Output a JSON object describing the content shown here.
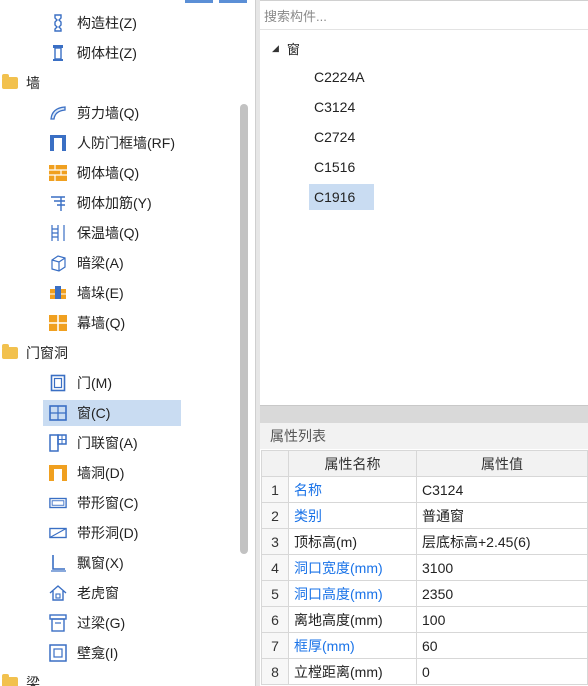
{
  "tree": {
    "items": [
      {
        "label": "构造柱(Z)",
        "icon": "constructional-column-icon",
        "level": 2
      },
      {
        "label": "砌体柱(Z)",
        "icon": "masonry-column-icon",
        "level": 2
      },
      {
        "label": "墙",
        "icon": "folder-icon",
        "level": 1
      },
      {
        "label": "剪力墙(Q)",
        "icon": "shear-wall-icon",
        "level": 2
      },
      {
        "label": "人防门框墙(RF)",
        "icon": "civil-defense-door-frame-wall-icon",
        "level": 2
      },
      {
        "label": "砌体墙(Q)",
        "icon": "masonry-wall-icon",
        "level": 2
      },
      {
        "label": "砌体加筋(Y)",
        "icon": "masonry-reinforcement-icon",
        "level": 2
      },
      {
        "label": "保温墙(Q)",
        "icon": "insulation-wall-icon",
        "level": 2
      },
      {
        "label": "暗梁(A)",
        "icon": "hidden-beam-icon",
        "level": 2
      },
      {
        "label": "墙垛(E)",
        "icon": "wall-pier-icon",
        "level": 2
      },
      {
        "label": "幕墙(Q)",
        "icon": "curtain-wall-icon",
        "level": 2
      },
      {
        "label": "门窗洞",
        "icon": "folder-icon",
        "level": 1
      },
      {
        "label": "门(M)",
        "icon": "door-icon",
        "level": 2
      },
      {
        "label": "窗(C)",
        "icon": "window-icon",
        "level": 2,
        "selected": true
      },
      {
        "label": "门联窗(A)",
        "icon": "door-window-icon",
        "level": 2
      },
      {
        "label": "墙洞(D)",
        "icon": "wall-hole-icon",
        "level": 2
      },
      {
        "label": "带形窗(C)",
        "icon": "strip-window-icon",
        "level": 2
      },
      {
        "label": "带形洞(D)",
        "icon": "strip-hole-icon",
        "level": 2
      },
      {
        "label": "飘窗(X)",
        "icon": "bay-window-icon",
        "level": 2
      },
      {
        "label": "老虎窗",
        "icon": "dormer-window-icon",
        "level": 2
      },
      {
        "label": "过梁(G)",
        "icon": "lintel-icon",
        "level": 2
      },
      {
        "label": "壁龛(I)",
        "icon": "niche-icon",
        "level": 2
      },
      {
        "label": "梁",
        "icon": "folder-icon",
        "level": 1
      }
    ]
  },
  "search": {
    "placeholder": "搜索构件..."
  },
  "components": {
    "root_label": "窗",
    "items": [
      {
        "label": "C2224A"
      },
      {
        "label": "C3124"
      },
      {
        "label": "C2724"
      },
      {
        "label": "C1516"
      },
      {
        "label": "C1916",
        "selected": true
      }
    ]
  },
  "properties": {
    "title": "属性列表",
    "col_name": "属性名称",
    "col_value": "属性值",
    "rows": [
      {
        "idx": "1",
        "name": "名称",
        "value": "C3124",
        "link": true
      },
      {
        "idx": "2",
        "name": "类别",
        "value": "普通窗",
        "link": true
      },
      {
        "idx": "3",
        "name": "顶标高(m)",
        "value": "层底标高+2.45(6)",
        "link": false
      },
      {
        "idx": "4",
        "name": "洞口宽度(mm)",
        "value": "3100",
        "link": true
      },
      {
        "idx": "5",
        "name": "洞口高度(mm)",
        "value": "2350",
        "link": true
      },
      {
        "idx": "6",
        "name": "离地高度(mm)",
        "value": "100",
        "link": false
      },
      {
        "idx": "7",
        "name": "框厚(mm)",
        "value": "60",
        "link": true
      },
      {
        "idx": "8",
        "name": "立樘距离(mm)",
        "value": "0",
        "link": false
      }
    ]
  },
  "colors": {
    "selection": "#c9dcf2",
    "link": "#1a73e8",
    "folder": "#f2c14e",
    "icon_blue": "#3a6fc4",
    "icon_orange": "#f0a020"
  }
}
